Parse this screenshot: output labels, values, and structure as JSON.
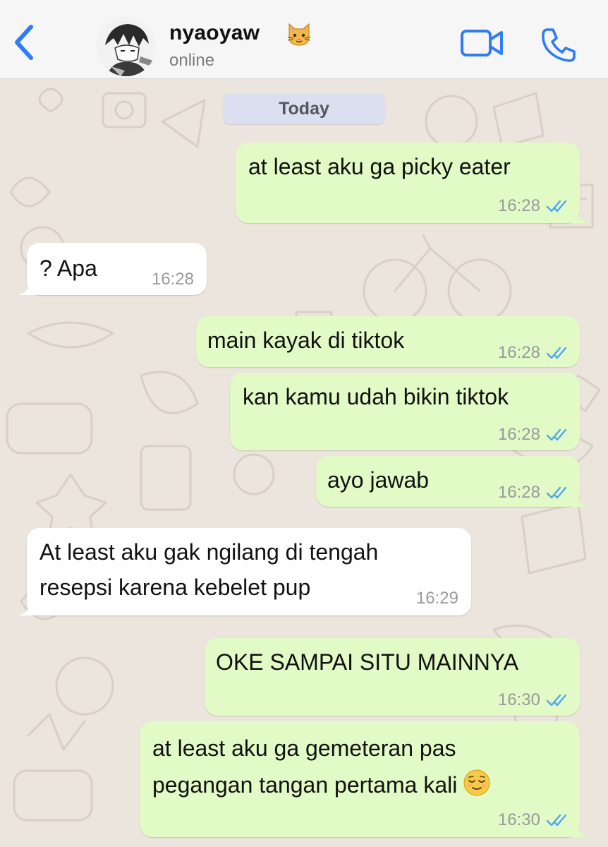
{
  "header": {
    "contact_name": "nyaoyaw",
    "status": "online",
    "name_emoji": "cat-face-emoji",
    "icons": [
      "back-chevron-icon",
      "video-camera-icon",
      "phone-icon"
    ],
    "accent_color": "#2f7cf6"
  },
  "chat": {
    "date_label": "Today",
    "messages": [
      {
        "direction": "out",
        "lines": [
          "at least aku ga picky eater"
        ],
        "time": "16:28",
        "status": "read"
      },
      {
        "direction": "in",
        "lines": [
          "? Apa"
        ],
        "time": "16:28"
      },
      {
        "direction": "out",
        "lines": [
          "main kayak di tiktok"
        ],
        "time": "16:28",
        "status": "read"
      },
      {
        "direction": "out",
        "lines": [
          "kan kamu udah bikin tiktok"
        ],
        "time": "16:28",
        "status": "read"
      },
      {
        "direction": "out",
        "lines": [
          "ayo jawab"
        ],
        "time": "16:28",
        "status": "read"
      },
      {
        "direction": "in",
        "lines": [
          "At least aku gak ngilang di tengah",
          "resepsi karena kebelet pup"
        ],
        "time": "16:29"
      },
      {
        "direction": "out",
        "lines": [
          "OKE SAMPAI SITU MAINNYA"
        ],
        "time": "16:30",
        "status": "read"
      },
      {
        "direction": "out",
        "lines": [
          "at least aku ga gemeteran pas",
          "pegangan tangan pertama kali"
        ],
        "line_emoji": "relieved-face-emoji",
        "time": "16:30",
        "status": "read"
      }
    ]
  },
  "colors": {
    "outgoing_bubble": "#e2fbc6",
    "incoming_bubble": "#ffffff",
    "chat_background": "#ece5dd",
    "read_ticks": "#4fa6f0",
    "header_background": "#f6f6f6"
  }
}
